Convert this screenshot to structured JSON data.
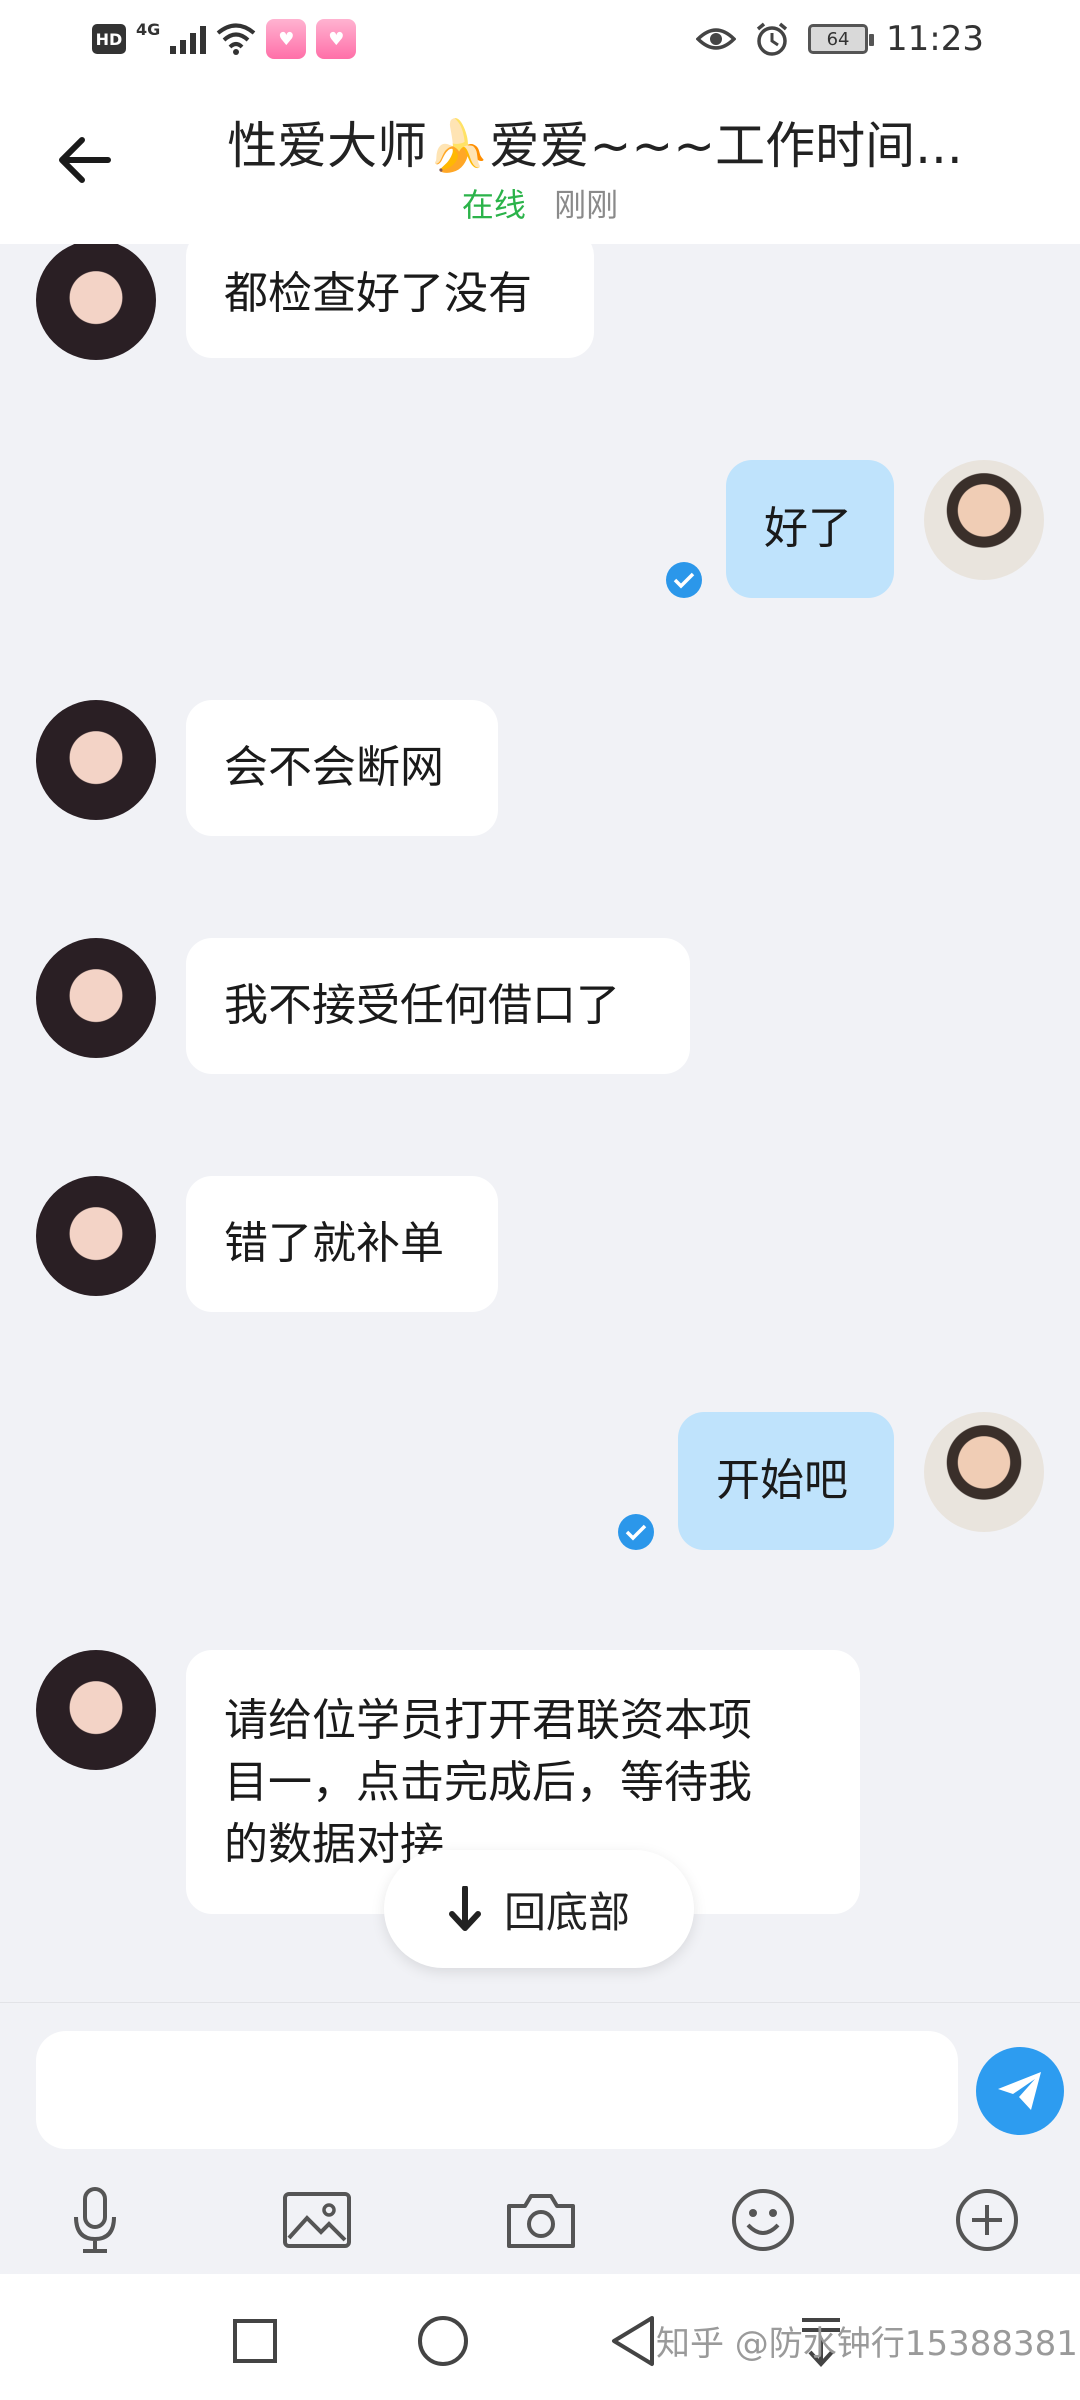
{
  "status_bar": {
    "hd": "HD",
    "network": "4G",
    "battery": "64",
    "time": "11:23"
  },
  "header": {
    "title": "性爱大师🍌爱爱~~~工作时间...",
    "online": "在线",
    "last_seen": "刚刚"
  },
  "messages": [
    {
      "side": "in",
      "text": "都检查好了没有"
    },
    {
      "side": "out",
      "text": "好了",
      "read": true
    },
    {
      "side": "in",
      "text": "会不会断网"
    },
    {
      "side": "in",
      "text": "我不接受任何借口了"
    },
    {
      "side": "in",
      "text": "错了就补单"
    },
    {
      "side": "out",
      "text": "开始吧",
      "read": true
    },
    {
      "side": "in",
      "lines": [
        "请给位学员打开君联资本项",
        "目一，点击完成后，等待我",
        "的数据对接"
      ]
    }
  ],
  "scroll_to_bottom": "回底部",
  "composer": {
    "placeholder": "",
    "tools": [
      "mic-icon",
      "image-icon",
      "camera-icon",
      "emoji-icon",
      "plus-icon"
    ]
  },
  "watermark": "知乎 @防水钟行15388381...",
  "colors": {
    "outgoing_bubble": "#bfe3fc",
    "incoming_bubble": "#ffffff",
    "accent": "#2d9cf0",
    "online": "#2bb34a",
    "background": "#f1f2f6"
  }
}
